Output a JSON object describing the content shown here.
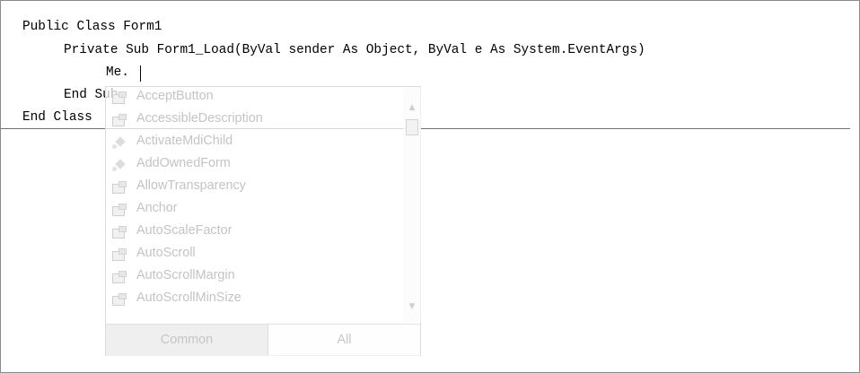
{
  "code": {
    "line1": "Public Class Form1",
    "line2": "Private Sub Form1_Load(ByVal sender As Object, ByVal e As System.EventArgs)",
    "line3": "Me.",
    "line4": "End Sub",
    "line5": "End Class"
  },
  "intellisense": {
    "items": [
      {
        "label": "AcceptButton",
        "icon": "property-icon"
      },
      {
        "label": "AccessibleDescription",
        "icon": "property-icon"
      },
      {
        "label": "ActivateMdiChild",
        "icon": "method-icon"
      },
      {
        "label": "AddOwnedForm",
        "icon": "method-icon"
      },
      {
        "label": "AllowTransparency",
        "icon": "property-icon"
      },
      {
        "label": "Anchor",
        "icon": "property-icon"
      },
      {
        "label": "AutoScaleFactor",
        "icon": "property-icon"
      },
      {
        "label": "AutoScroll",
        "icon": "property-icon"
      },
      {
        "label": "AutoScrollMargin",
        "icon": "property-icon"
      },
      {
        "label": "AutoScrollMinSize",
        "icon": "property-icon"
      }
    ],
    "tabs": {
      "common": "Common",
      "all": "All"
    }
  }
}
